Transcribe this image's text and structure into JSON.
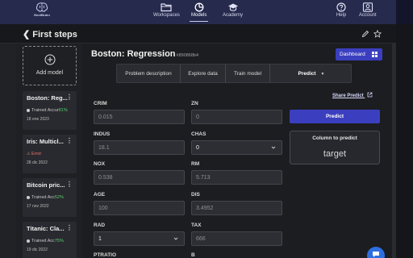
{
  "nav": {
    "brand": "NextBrain",
    "items": [
      {
        "label": "Workspaces",
        "icon": "folder-icon"
      },
      {
        "label": "Models",
        "icon": "chart-pie-icon",
        "active": true
      },
      {
        "label": "Academy",
        "icon": "graduation-cap-icon"
      },
      {
        "label": "Help",
        "icon": "help-icon"
      },
      {
        "label": "Account",
        "icon": "account-icon"
      }
    ]
  },
  "header": {
    "back_label": "First steps",
    "edit_icon": "pencil-icon",
    "star_icon": "star-icon"
  },
  "sidebar": {
    "add_model_label": "Add model",
    "models": [
      {
        "title": "Boston: Reg...",
        "status": "Trained",
        "accuracy_label": "Accur",
        "accuracy": "81%",
        "date": "18 ene 2023"
      },
      {
        "title": "Iris: Multicl...",
        "status": "Error",
        "accuracy_label": "",
        "accuracy": "",
        "date": "28 dic 2022"
      },
      {
        "title": "Bitcoin pric...",
        "status": "Trained",
        "accuracy_label": "Acc",
        "accuracy": "52%",
        "date": "17 nov 2022"
      },
      {
        "title": "Titanic: Cla...",
        "status": "Trained",
        "accuracy_label": "Acc",
        "accuracy": "75%",
        "date": "19 dic 2022"
      }
    ]
  },
  "main": {
    "title": "Boston: Regression",
    "model_id": "#890868b4",
    "dashboard_label": "Dashboard",
    "tabs": [
      {
        "label": "Problem description"
      },
      {
        "label": "Explore data"
      },
      {
        "label": "Train model"
      },
      {
        "label": "Predict",
        "active": true
      }
    ],
    "share_label": "Share Predict",
    "predict_label": "Predict",
    "column_panel": {
      "title": "Column to predict",
      "value": "target"
    },
    "fields": [
      {
        "label": "CRIM",
        "value": "0.015",
        "type": "input"
      },
      {
        "label": "ZN",
        "value": "0",
        "type": "input"
      },
      {
        "label": "INDUS",
        "value": "18.1",
        "type": "input"
      },
      {
        "label": "CHAS",
        "value": "0",
        "type": "select"
      },
      {
        "label": "NOX",
        "value": "0.538",
        "type": "input"
      },
      {
        "label": "RM",
        "value": "5.713",
        "type": "input"
      },
      {
        "label": "AGE",
        "value": "100",
        "type": "input"
      },
      {
        "label": "DIS",
        "value": "3.4952",
        "type": "input"
      },
      {
        "label": "RAD",
        "value": "1",
        "type": "select"
      },
      {
        "label": "TAX",
        "value": "666",
        "type": "input"
      },
      {
        "label": "PTRATIO",
        "value": "",
        "type": "input"
      },
      {
        "label": "B",
        "value": "",
        "type": "input"
      }
    ]
  },
  "colors": {
    "nav_bg": "#262a4d",
    "accent": "#3b3fbf",
    "success": "#57d06b",
    "error": "#f27272",
    "chat": "#2e6fe0"
  }
}
